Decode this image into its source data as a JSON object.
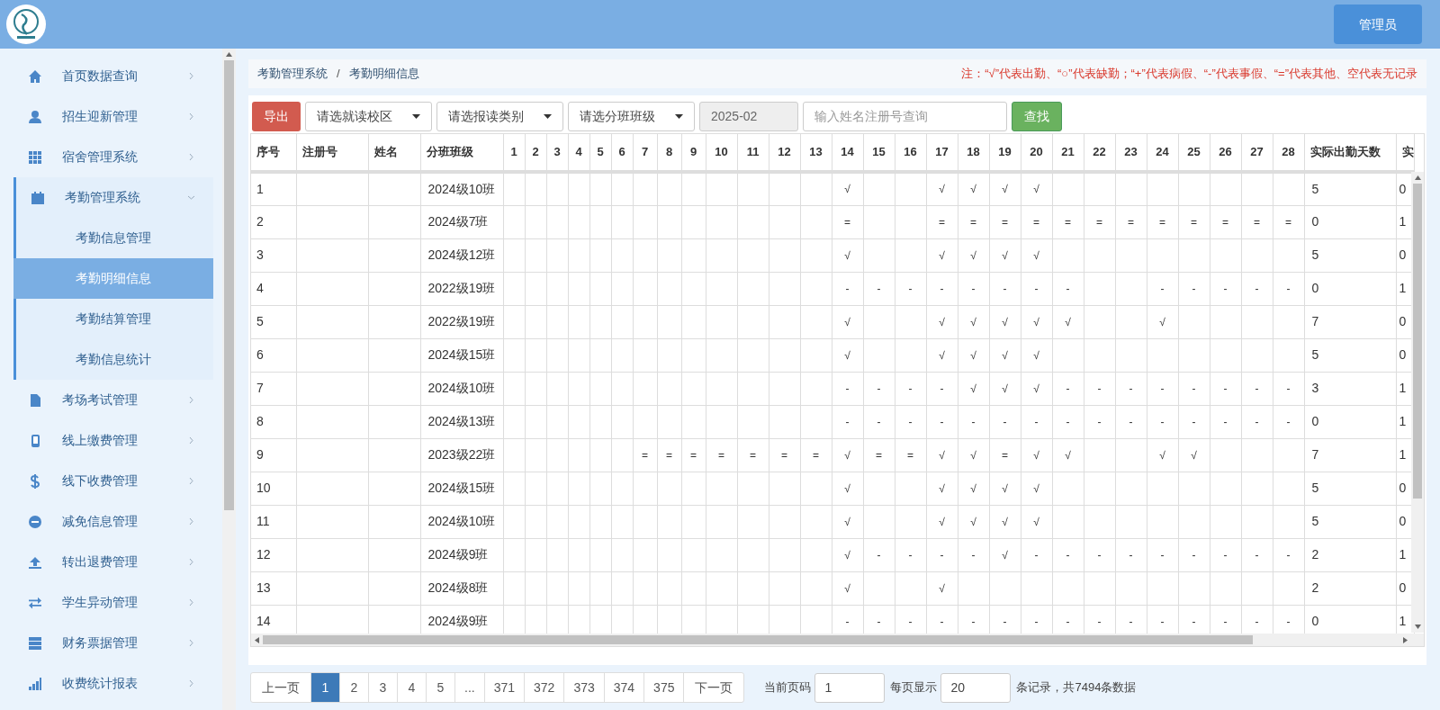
{
  "header": {
    "user_button": "管理员"
  },
  "sidebar": {
    "items": [
      {
        "label": "首页数据查询",
        "expanded": false
      },
      {
        "label": "招生迎新管理",
        "expanded": false
      },
      {
        "label": "宿舍管理系统",
        "expanded": false
      },
      {
        "label": "考勤管理系统",
        "expanded": true,
        "children": [
          {
            "label": "考勤信息管理",
            "selected": false
          },
          {
            "label": "考勤明细信息",
            "selected": true
          },
          {
            "label": "考勤结算管理",
            "selected": false
          },
          {
            "label": "考勤信息统计",
            "selected": false
          }
        ]
      },
      {
        "label": "考场考试管理",
        "expanded": false
      },
      {
        "label": "线上缴费管理",
        "expanded": false
      },
      {
        "label": "线下收费管理",
        "expanded": false
      },
      {
        "label": "减免信息管理",
        "expanded": false
      },
      {
        "label": "转出退费管理",
        "expanded": false
      },
      {
        "label": "学生异动管理",
        "expanded": false
      },
      {
        "label": "财务票据管理",
        "expanded": false
      },
      {
        "label": "收费统计报表",
        "expanded": false
      }
    ]
  },
  "breadcrumb": [
    "考勤管理系统",
    "考勤明细信息"
  ],
  "breadcrumb_separator": "/",
  "legend_note": "注：“√”代表出勤、“○”代表缺勤；“+”代表病假、“-”代表事假、“=”代表其他、空代表无记录",
  "toolbar": {
    "export_button": "导出",
    "selects": [
      "请选就读校区",
      "请选报读类别",
      "请选分班班级"
    ],
    "month": {
      "value": "2025-02",
      "disabled": true
    },
    "search": {
      "placeholder": "输入姓名注册号查询"
    },
    "search_button": "查找"
  },
  "table": {
    "columns": [
      "序号",
      "注册号",
      "姓名",
      "分班班级",
      "1",
      "2",
      "3",
      "4",
      "5",
      "6",
      "7",
      "8",
      "9",
      "10",
      "11",
      "12",
      "13",
      "14",
      "15",
      "16",
      "17",
      "18",
      "19",
      "20",
      "21",
      "22",
      "23",
      "24",
      "25",
      "26",
      "27",
      "28",
      "实际出勤天数",
      "实"
    ],
    "rows": [
      {
        "no": "1",
        "class": "2024级10班",
        "days": [
          {
            "kind": "blank"
          },
          {
            "kind": "blank"
          },
          {
            "kind": "blank"
          },
          {
            "kind": "blank"
          },
          {
            "kind": "blank"
          },
          {
            "kind": "blank"
          },
          {
            "kind": "blank"
          },
          {
            "kind": "blank"
          },
          {
            "kind": "blank"
          },
          {
            "kind": "blank"
          },
          {
            "kind": "blank"
          },
          {
            "kind": "blank"
          },
          {
            "kind": "blank"
          },
          {
            "kind": "mark",
            "mark": "√"
          },
          {
            "kind": "blank"
          },
          {
            "kind": "blank"
          },
          {
            "kind": "mark",
            "mark": "√"
          },
          {
            "kind": "mark",
            "mark": "√"
          },
          {
            "kind": "mark",
            "mark": "√"
          },
          {
            "kind": "mark",
            "mark": "√"
          },
          {
            "kind": "blank"
          },
          {
            "kind": "blank"
          },
          {
            "kind": "blank"
          },
          {
            "kind": "blank"
          },
          {
            "kind": "blank"
          },
          {
            "kind": "blank"
          },
          {
            "kind": "blank"
          },
          {
            "kind": "blank"
          }
        ],
        "attended": "5",
        "column_34": "0"
      },
      {
        "no": "2",
        "class": "2024级7班",
        "days": [
          {
            "kind": "blank"
          },
          {
            "kind": "blank"
          },
          {
            "kind": "blank"
          },
          {
            "kind": "blank"
          },
          {
            "kind": "blank"
          },
          {
            "kind": "blank"
          },
          {
            "kind": "blank"
          },
          {
            "kind": "blank"
          },
          {
            "kind": "blank"
          },
          {
            "kind": "blank"
          },
          {
            "kind": "blank"
          },
          {
            "kind": "blank"
          },
          {
            "kind": "blank"
          },
          {
            "kind": "mark",
            "mark": "="
          },
          {
            "kind": "blank"
          },
          {
            "kind": "blank"
          },
          {
            "kind": "mark",
            "mark": "="
          },
          {
            "kind": "mark",
            "mark": "="
          },
          {
            "kind": "mark",
            "mark": "="
          },
          {
            "kind": "mark",
            "mark": "="
          },
          {
            "kind": "mark",
            "mark": "="
          },
          {
            "kind": "mark",
            "mark": "="
          },
          {
            "kind": "mark",
            "mark": "="
          },
          {
            "kind": "mark",
            "mark": "="
          },
          {
            "kind": "mark",
            "mark": "="
          },
          {
            "kind": "mark",
            "mark": "="
          },
          {
            "kind": "mark",
            "mark": "="
          },
          {
            "kind": "mark",
            "mark": "="
          }
        ],
        "attended": "0",
        "column_34": "1"
      },
      {
        "no": "3",
        "class": "2024级12班",
        "days": [
          {
            "kind": "blank"
          },
          {
            "kind": "blank"
          },
          {
            "kind": "blank"
          },
          {
            "kind": "blank"
          },
          {
            "kind": "blank"
          },
          {
            "kind": "blank"
          },
          {
            "kind": "blank"
          },
          {
            "kind": "blank"
          },
          {
            "kind": "blank"
          },
          {
            "kind": "blank"
          },
          {
            "kind": "blank"
          },
          {
            "kind": "blank"
          },
          {
            "kind": "blank"
          },
          {
            "kind": "mark",
            "mark": "√"
          },
          {
            "kind": "blank"
          },
          {
            "kind": "blank"
          },
          {
            "kind": "mark",
            "mark": "√"
          },
          {
            "kind": "mark",
            "mark": "√"
          },
          {
            "kind": "mark",
            "mark": "√"
          },
          {
            "kind": "mark",
            "mark": "√"
          },
          {
            "kind": "blank"
          },
          {
            "kind": "blank"
          },
          {
            "kind": "blank"
          },
          {
            "kind": "blank"
          },
          {
            "kind": "blank"
          },
          {
            "kind": "blank"
          },
          {
            "kind": "blank"
          },
          {
            "kind": "blank"
          }
        ],
        "attended": "5",
        "column_34": "0"
      },
      {
        "no": "4",
        "class": "2022级19班",
        "days": [
          {
            "kind": "blank"
          },
          {
            "kind": "blank"
          },
          {
            "kind": "blank"
          },
          {
            "kind": "blank"
          },
          {
            "kind": "blank"
          },
          {
            "kind": "blank"
          },
          {
            "kind": "blank"
          },
          {
            "kind": "blank"
          },
          {
            "kind": "blank"
          },
          {
            "kind": "blank"
          },
          {
            "kind": "blank"
          },
          {
            "kind": "blank"
          },
          {
            "kind": "blank"
          },
          {
            "kind": "mark",
            "mark": "-"
          },
          {
            "kind": "mark",
            "mark": "-"
          },
          {
            "kind": "mark",
            "mark": "-"
          },
          {
            "kind": "mark",
            "mark": "-"
          },
          {
            "kind": "mark",
            "mark": "-"
          },
          {
            "kind": "mark",
            "mark": "-"
          },
          {
            "kind": "mark",
            "mark": "-"
          },
          {
            "kind": "mark",
            "mark": "-"
          },
          {
            "kind": "blank"
          },
          {
            "kind": "blank"
          },
          {
            "kind": "mark",
            "mark": "-"
          },
          {
            "kind": "mark",
            "mark": "-"
          },
          {
            "kind": "mark",
            "mark": "-"
          },
          {
            "kind": "mark",
            "mark": "-"
          },
          {
            "kind": "mark",
            "mark": "-"
          }
        ],
        "attended": "0",
        "column_34": "1"
      },
      {
        "no": "5",
        "class": "2022级19班",
        "days": [
          {
            "kind": "blank"
          },
          {
            "kind": "blank"
          },
          {
            "kind": "blank"
          },
          {
            "kind": "blank"
          },
          {
            "kind": "blank"
          },
          {
            "kind": "blank"
          },
          {
            "kind": "blank"
          },
          {
            "kind": "blank"
          },
          {
            "kind": "blank"
          },
          {
            "kind": "blank"
          },
          {
            "kind": "blank"
          },
          {
            "kind": "blank"
          },
          {
            "kind": "blank"
          },
          {
            "kind": "mark",
            "mark": "√"
          },
          {
            "kind": "blank"
          },
          {
            "kind": "blank"
          },
          {
            "kind": "mark",
            "mark": "√"
          },
          {
            "kind": "mark",
            "mark": "√"
          },
          {
            "kind": "mark",
            "mark": "√"
          },
          {
            "kind": "mark",
            "mark": "√"
          },
          {
            "kind": "mark",
            "mark": "√"
          },
          {
            "kind": "blank"
          },
          {
            "kind": "blank"
          },
          {
            "kind": "mark",
            "mark": "√"
          },
          {
            "kind": "blank"
          },
          {
            "kind": "blank"
          },
          {
            "kind": "blank"
          },
          {
            "kind": "blank"
          }
        ],
        "attended": "7",
        "column_34": "0"
      },
      {
        "no": "6",
        "class": "2024级15班",
        "days": [
          {
            "kind": "blank"
          },
          {
            "kind": "blank"
          },
          {
            "kind": "blank"
          },
          {
            "kind": "blank"
          },
          {
            "kind": "blank"
          },
          {
            "kind": "blank"
          },
          {
            "kind": "blank"
          },
          {
            "kind": "blank"
          },
          {
            "kind": "blank"
          },
          {
            "kind": "blank"
          },
          {
            "kind": "blank"
          },
          {
            "kind": "blank"
          },
          {
            "kind": "blank"
          },
          {
            "kind": "mark",
            "mark": "√"
          },
          {
            "kind": "blank"
          },
          {
            "kind": "blank"
          },
          {
            "kind": "mark",
            "mark": "√"
          },
          {
            "kind": "mark",
            "mark": "√"
          },
          {
            "kind": "mark",
            "mark": "√"
          },
          {
            "kind": "mark",
            "mark": "√"
          },
          {
            "kind": "blank"
          },
          {
            "kind": "blank"
          },
          {
            "kind": "blank"
          },
          {
            "kind": "blank"
          },
          {
            "kind": "blank"
          },
          {
            "kind": "blank"
          },
          {
            "kind": "blank"
          },
          {
            "kind": "blank"
          }
        ],
        "attended": "5",
        "column_34": "0"
      },
      {
        "no": "7",
        "class": "2024级10班",
        "days": [
          {
            "kind": "blank"
          },
          {
            "kind": "blank"
          },
          {
            "kind": "blank"
          },
          {
            "kind": "blank"
          },
          {
            "kind": "blank"
          },
          {
            "kind": "blank"
          },
          {
            "kind": "blank"
          },
          {
            "kind": "blank"
          },
          {
            "kind": "blank"
          },
          {
            "kind": "blank"
          },
          {
            "kind": "blank"
          },
          {
            "kind": "blank"
          },
          {
            "kind": "blank"
          },
          {
            "kind": "mark",
            "mark": "-"
          },
          {
            "kind": "mark",
            "mark": "-"
          },
          {
            "kind": "mark",
            "mark": "-"
          },
          {
            "kind": "mark",
            "mark": "-"
          },
          {
            "kind": "mark",
            "mark": "√"
          },
          {
            "kind": "mark",
            "mark": "√"
          },
          {
            "kind": "mark",
            "mark": "√"
          },
          {
            "kind": "mark",
            "mark": "-"
          },
          {
            "kind": "mark",
            "mark": "-"
          },
          {
            "kind": "mark",
            "mark": "-"
          },
          {
            "kind": "mark",
            "mark": "-"
          },
          {
            "kind": "mark",
            "mark": "-"
          },
          {
            "kind": "mark",
            "mark": "-"
          },
          {
            "kind": "mark",
            "mark": "-"
          },
          {
            "kind": "mark",
            "mark": "-"
          }
        ],
        "attended": "3",
        "column_34": "1"
      },
      {
        "no": "8",
        "class": "2024级13班",
        "days": [
          {
            "kind": "blank"
          },
          {
            "kind": "blank"
          },
          {
            "kind": "blank"
          },
          {
            "kind": "blank"
          },
          {
            "kind": "blank"
          },
          {
            "kind": "blank"
          },
          {
            "kind": "blank"
          },
          {
            "kind": "blank"
          },
          {
            "kind": "blank"
          },
          {
            "kind": "blank"
          },
          {
            "kind": "blank"
          },
          {
            "kind": "blank"
          },
          {
            "kind": "blank"
          },
          {
            "kind": "mark",
            "mark": "-"
          },
          {
            "kind": "mark",
            "mark": "-"
          },
          {
            "kind": "mark",
            "mark": "-"
          },
          {
            "kind": "mark",
            "mark": "-"
          },
          {
            "kind": "mark",
            "mark": "-"
          },
          {
            "kind": "mark",
            "mark": "-"
          },
          {
            "kind": "mark",
            "mark": "-"
          },
          {
            "kind": "mark",
            "mark": "-"
          },
          {
            "kind": "mark",
            "mark": "-"
          },
          {
            "kind": "mark",
            "mark": "-"
          },
          {
            "kind": "mark",
            "mark": "-"
          },
          {
            "kind": "mark",
            "mark": "-"
          },
          {
            "kind": "mark",
            "mark": "-"
          },
          {
            "kind": "mark",
            "mark": "-"
          },
          {
            "kind": "mark",
            "mark": "-"
          }
        ],
        "attended": "0",
        "column_34": "1"
      },
      {
        "no": "9",
        "class": "2023级22班",
        "days": [
          {
            "kind": "blank"
          },
          {
            "kind": "blank"
          },
          {
            "kind": "blank"
          },
          {
            "kind": "blank"
          },
          {
            "kind": "blank"
          },
          {
            "kind": "blank"
          },
          {
            "kind": "mark",
            "mark": "="
          },
          {
            "kind": "mark",
            "mark": "="
          },
          {
            "kind": "mark",
            "mark": "="
          },
          {
            "kind": "mark",
            "mark": "="
          },
          {
            "kind": "mark",
            "mark": "="
          },
          {
            "kind": "mark",
            "mark": "="
          },
          {
            "kind": "mark",
            "mark": "="
          },
          {
            "kind": "mark",
            "mark": "√"
          },
          {
            "kind": "mark",
            "mark": "="
          },
          {
            "kind": "mark",
            "mark": "="
          },
          {
            "kind": "mark",
            "mark": "√"
          },
          {
            "kind": "mark",
            "mark": "√"
          },
          {
            "kind": "mark",
            "mark": "="
          },
          {
            "kind": "mark",
            "mark": "√"
          },
          {
            "kind": "mark",
            "mark": "√"
          },
          {
            "kind": "blank"
          },
          {
            "kind": "blank"
          },
          {
            "kind": "mark",
            "mark": "√"
          },
          {
            "kind": "mark",
            "mark": "√"
          },
          {
            "kind": "blank"
          },
          {
            "kind": "blank"
          },
          {
            "kind": "blank"
          }
        ],
        "attended": "7",
        "column_34": "1"
      },
      {
        "no": "10",
        "class": "2024级15班",
        "days": [
          {
            "kind": "blank"
          },
          {
            "kind": "blank"
          },
          {
            "kind": "blank"
          },
          {
            "kind": "blank"
          },
          {
            "kind": "blank"
          },
          {
            "kind": "blank"
          },
          {
            "kind": "blank"
          },
          {
            "kind": "blank"
          },
          {
            "kind": "blank"
          },
          {
            "kind": "blank"
          },
          {
            "kind": "blank"
          },
          {
            "kind": "blank"
          },
          {
            "kind": "blank"
          },
          {
            "kind": "mark",
            "mark": "√"
          },
          {
            "kind": "blank"
          },
          {
            "kind": "blank"
          },
          {
            "kind": "mark",
            "mark": "√"
          },
          {
            "kind": "mark",
            "mark": "√"
          },
          {
            "kind": "mark",
            "mark": "√"
          },
          {
            "kind": "mark",
            "mark": "√"
          },
          {
            "kind": "blank"
          },
          {
            "kind": "blank"
          },
          {
            "kind": "blank"
          },
          {
            "kind": "blank"
          },
          {
            "kind": "blank"
          },
          {
            "kind": "blank"
          },
          {
            "kind": "blank"
          },
          {
            "kind": "blank"
          }
        ],
        "attended": "5",
        "column_34": "0"
      },
      {
        "no": "11",
        "class": "2024级10班",
        "days": [
          {
            "kind": "blank"
          },
          {
            "kind": "blank"
          },
          {
            "kind": "blank"
          },
          {
            "kind": "blank"
          },
          {
            "kind": "blank"
          },
          {
            "kind": "blank"
          },
          {
            "kind": "blank"
          },
          {
            "kind": "blank"
          },
          {
            "kind": "blank"
          },
          {
            "kind": "blank"
          },
          {
            "kind": "blank"
          },
          {
            "kind": "blank"
          },
          {
            "kind": "blank"
          },
          {
            "kind": "mark",
            "mark": "√"
          },
          {
            "kind": "blank"
          },
          {
            "kind": "blank"
          },
          {
            "kind": "mark",
            "mark": "√"
          },
          {
            "kind": "mark",
            "mark": "√"
          },
          {
            "kind": "mark",
            "mark": "√"
          },
          {
            "kind": "mark",
            "mark": "√"
          },
          {
            "kind": "blank"
          },
          {
            "kind": "blank"
          },
          {
            "kind": "blank"
          },
          {
            "kind": "blank"
          },
          {
            "kind": "blank"
          },
          {
            "kind": "blank"
          },
          {
            "kind": "blank"
          },
          {
            "kind": "blank"
          }
        ],
        "attended": "5",
        "column_34": "0"
      },
      {
        "no": "12",
        "class": "2024级9班",
        "days": [
          {
            "kind": "blank"
          },
          {
            "kind": "blank"
          },
          {
            "kind": "blank"
          },
          {
            "kind": "blank"
          },
          {
            "kind": "blank"
          },
          {
            "kind": "blank"
          },
          {
            "kind": "blank"
          },
          {
            "kind": "blank"
          },
          {
            "kind": "blank"
          },
          {
            "kind": "blank"
          },
          {
            "kind": "blank"
          },
          {
            "kind": "blank"
          },
          {
            "kind": "blank"
          },
          {
            "kind": "mark",
            "mark": "√"
          },
          {
            "kind": "mark",
            "mark": "-"
          },
          {
            "kind": "mark",
            "mark": "-"
          },
          {
            "kind": "mark",
            "mark": "-"
          },
          {
            "kind": "mark",
            "mark": "-"
          },
          {
            "kind": "mark",
            "mark": "√"
          },
          {
            "kind": "mark",
            "mark": "-"
          },
          {
            "kind": "mark",
            "mark": "-"
          },
          {
            "kind": "mark",
            "mark": "-"
          },
          {
            "kind": "mark",
            "mark": "-"
          },
          {
            "kind": "mark",
            "mark": "-"
          },
          {
            "kind": "mark",
            "mark": "-"
          },
          {
            "kind": "mark",
            "mark": "-"
          },
          {
            "kind": "mark",
            "mark": "-"
          },
          {
            "kind": "mark",
            "mark": "-"
          }
        ],
        "attended": "2",
        "column_34": "1"
      },
      {
        "no": "13",
        "class": "2024级8班",
        "days": [
          {
            "kind": "blank"
          },
          {
            "kind": "blank"
          },
          {
            "kind": "blank"
          },
          {
            "kind": "blank"
          },
          {
            "kind": "blank"
          },
          {
            "kind": "blank"
          },
          {
            "kind": "blank"
          },
          {
            "kind": "blank"
          },
          {
            "kind": "blank"
          },
          {
            "kind": "blank"
          },
          {
            "kind": "blank"
          },
          {
            "kind": "blank"
          },
          {
            "kind": "blank"
          },
          {
            "kind": "mark",
            "mark": "√"
          },
          {
            "kind": "blank"
          },
          {
            "kind": "blank"
          },
          {
            "kind": "mark",
            "mark": "√"
          },
          {
            "kind": "blank"
          },
          {
            "kind": "blank"
          },
          {
            "kind": "blank"
          },
          {
            "kind": "blank"
          },
          {
            "kind": "blank"
          },
          {
            "kind": "blank"
          },
          {
            "kind": "blank"
          },
          {
            "kind": "blank"
          },
          {
            "kind": "blank"
          },
          {
            "kind": "blank"
          },
          {
            "kind": "blank"
          }
        ],
        "attended": "2",
        "column_34": "0"
      },
      {
        "no": "14",
        "class": "2024级9班",
        "days": [
          {
            "kind": "blank"
          },
          {
            "kind": "blank"
          },
          {
            "kind": "blank"
          },
          {
            "kind": "blank"
          },
          {
            "kind": "blank"
          },
          {
            "kind": "blank"
          },
          {
            "kind": "blank"
          },
          {
            "kind": "blank"
          },
          {
            "kind": "blank"
          },
          {
            "kind": "blank"
          },
          {
            "kind": "blank"
          },
          {
            "kind": "blank"
          },
          {
            "kind": "blank"
          },
          {
            "kind": "mark",
            "mark": "-"
          },
          {
            "kind": "mark",
            "mark": "-"
          },
          {
            "kind": "mark",
            "mark": "-"
          },
          {
            "kind": "mark",
            "mark": "-"
          },
          {
            "kind": "mark",
            "mark": "-"
          },
          {
            "kind": "mark",
            "mark": "-"
          },
          {
            "kind": "mark",
            "mark": "-"
          },
          {
            "kind": "mark",
            "mark": "-"
          },
          {
            "kind": "mark",
            "mark": "-"
          },
          {
            "kind": "mark",
            "mark": "-"
          },
          {
            "kind": "mark",
            "mark": "-"
          },
          {
            "kind": "mark",
            "mark": "-"
          },
          {
            "kind": "mark",
            "mark": "-"
          },
          {
            "kind": "mark",
            "mark": "-"
          },
          {
            "kind": "mark",
            "mark": "-"
          }
        ],
        "attended": "0",
        "column_34": "1"
      }
    ]
  },
  "pagination": {
    "prev": "上一页",
    "pages": [
      {
        "label": "1",
        "selected": true
      },
      {
        "label": "2",
        "selected": false
      },
      {
        "label": "3",
        "selected": false
      },
      {
        "label": "4",
        "selected": false
      },
      {
        "label": "5",
        "selected": false
      },
      {
        "label": "...",
        "selected": false
      },
      {
        "label": "371",
        "selected": false
      },
      {
        "label": "372",
        "selected": false
      },
      {
        "label": "373",
        "selected": false
      },
      {
        "label": "374",
        "selected": false
      },
      {
        "label": "375",
        "selected": false
      }
    ],
    "next": "下一页",
    "current_page_label": "当前页码",
    "current_page": "1",
    "page_size_label": "每页显示",
    "page_size": "20",
    "summary": "条记录，共7494条数据"
  }
}
